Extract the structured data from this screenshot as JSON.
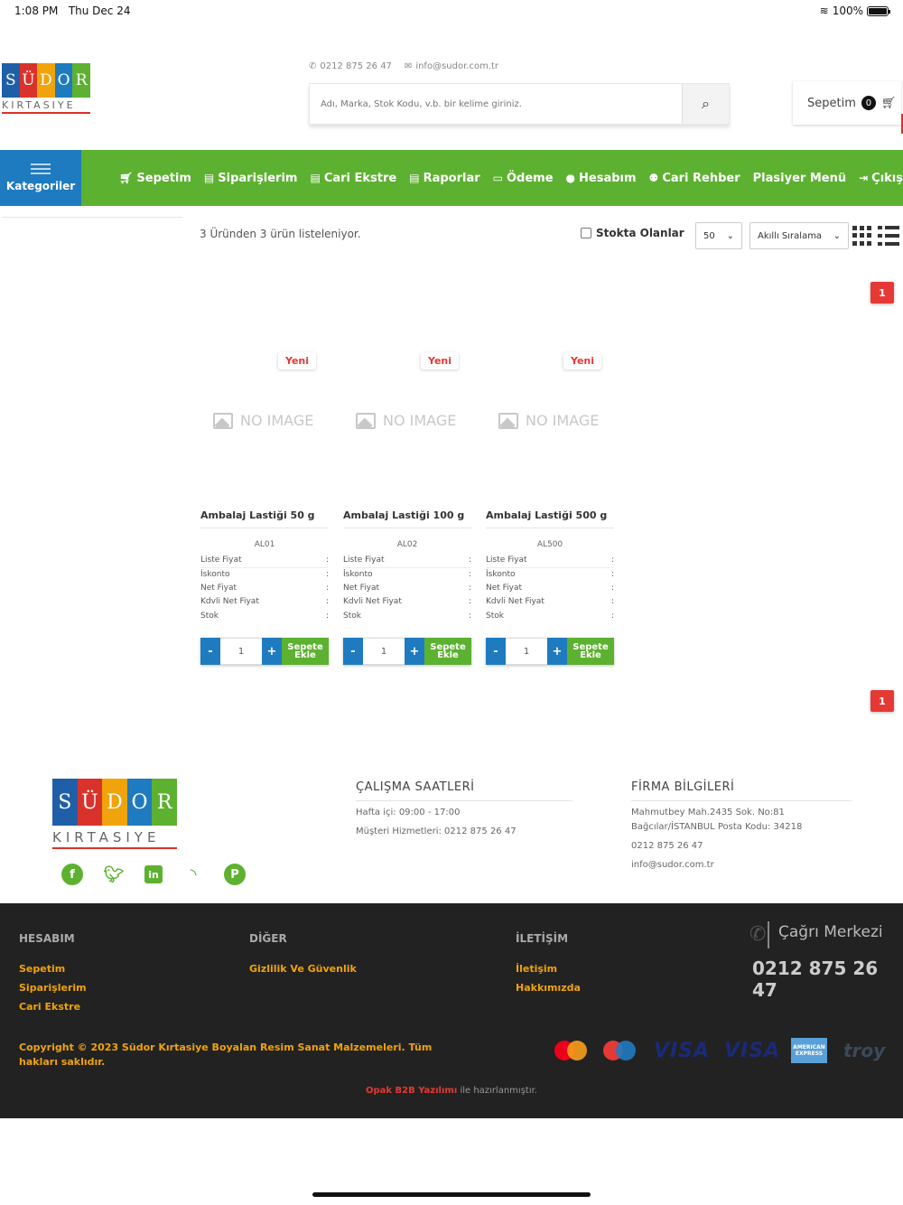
{
  "status_bar": {
    "time": "1:08 PM",
    "date": "Thu Dec 24",
    "battery": "100%"
  },
  "logo": {
    "letters": [
      "S",
      "Ü",
      "D",
      "O",
      "R"
    ],
    "tile_colors": [
      "#1f5fa8",
      "#d9322b",
      "#f0a30a",
      "#1f7bbf",
      "#5db130"
    ],
    "subtitle": "KIRTASIYE"
  },
  "header": {
    "phone": "0212 875 26 47",
    "email": "info@sudor.com.tr",
    "search_placeholder": "Adı, Marka, Stok Kodu, v.b. bir kelime giriniz.",
    "cart_label": "Sepetim",
    "cart_count": "0"
  },
  "nav": {
    "categories_label": "Kategoriler",
    "items": [
      {
        "label": "Sepetim",
        "icon": "cart-icon"
      },
      {
        "label": "Siparişlerim",
        "icon": "file-icon"
      },
      {
        "label": "Cari Ekstre",
        "icon": "file-icon"
      },
      {
        "label": "Raporlar",
        "icon": "file-icon"
      },
      {
        "label": "Ödeme",
        "icon": "credit-card-icon"
      },
      {
        "label": "Hesabım",
        "icon": "user-icon"
      },
      {
        "label": "Cari Rehber",
        "icon": "users-icon"
      },
      {
        "label": "Plasiyer Menü",
        "icon": ""
      },
      {
        "label": "Çıkış",
        "icon": "sign-out-icon"
      }
    ],
    "colors": {
      "bar": "#5db130",
      "categories": "#1f7bbf"
    }
  },
  "listing": {
    "result_text": "3 Üründen 3 ürün listeleniyor.",
    "stock_filter_label": "Stokta Olanlar",
    "page_size": "50",
    "sort": "Akıllı Sıralama",
    "page_top": "1",
    "page_bottom": "1"
  },
  "products": [
    {
      "badge": "Yeni",
      "no_image": "NO IMAGE",
      "name": "Ambalaj Lastiği 50 g",
      "code": "AL01",
      "specs": [
        {
          "label": "Liste Fiyat",
          "sep": ":"
        },
        {
          "label": "İskonto",
          "sep": ":"
        },
        {
          "label": "Net Fiyat",
          "sep": ":"
        },
        {
          "label": "Kdvli Net Fiyat",
          "sep": ":"
        },
        {
          "label": "Stok",
          "sep": ":"
        }
      ],
      "minus": "-",
      "qty": "1",
      "plus": "+",
      "add_label": "Sepete Ekle"
    },
    {
      "badge": "Yeni",
      "no_image": "NO IMAGE",
      "name": "Ambalaj Lastiği 100 g",
      "code": "AL02",
      "specs": [
        {
          "label": "Liste Fiyat",
          "sep": ":"
        },
        {
          "label": "İskonto",
          "sep": ":"
        },
        {
          "label": "Net Fiyat",
          "sep": ":"
        },
        {
          "label": "Kdvli Net Fiyat",
          "sep": ":"
        },
        {
          "label": "Stok",
          "sep": ":"
        }
      ],
      "minus": "-",
      "qty": "1",
      "plus": "+",
      "add_label": "Sepete Ekle"
    },
    {
      "badge": "Yeni",
      "no_image": "NO IMAGE",
      "name": "Ambalaj Lastiği 500 g",
      "code": "AL500",
      "specs": [
        {
          "label": "Liste Fiyat",
          "sep": ":"
        },
        {
          "label": "İskonto",
          "sep": ":"
        },
        {
          "label": "Net Fiyat",
          "sep": ":"
        },
        {
          "label": "Kdvli Net Fiyat",
          "sep": ":"
        },
        {
          "label": "Stok",
          "sep": ":"
        }
      ],
      "minus": "-",
      "qty": "1",
      "plus": "+",
      "add_label": "Sepete Ekle"
    }
  ],
  "footer": {
    "socials": [
      "facebook-icon",
      "twitter-icon",
      "linkedin-icon",
      "rss-icon",
      "pinterest-icon"
    ],
    "hours": {
      "title": "ÇALIŞMA SAATLERİ",
      "weekday": "Hafta içi: 09:00 - 17:00",
      "support": "Müşteri Hizmetleri: 0212 875 26 47"
    },
    "company": {
      "title": "FİRMA BİLGİLERİ",
      "address_1": "Mahmutbey Mah.2435 Sok. No:81",
      "address_2": "Bağcılar/İSTANBUL Posta Kodu: 34218",
      "phone": "0212 875 26 47",
      "email": "info@sudor.com.tr"
    },
    "account": {
      "title": "HESABIM",
      "links": [
        "Sepetim",
        "Siparişlerim",
        "Cari Ekstre"
      ]
    },
    "other": {
      "title": "DİĞER",
      "links": [
        "Gizlilik Ve Güvenlik"
      ]
    },
    "contact": {
      "title": "İLETİŞİM",
      "links": [
        "İletişim",
        "Hakkımızda"
      ]
    },
    "call_center": {
      "label": "Çağrı Merkezi",
      "number": "0212 875 26 47"
    },
    "copyright": "Copyright © 2023 Südor Kırtasiye Boyalan Resim Sanat Malzemeleri. Tüm hakları saklıdır.",
    "credit_brand": "Opak B2B Yazılımı",
    "credit_rest": " ile hazırlanmıştır.",
    "payment": {
      "visa": "VISA",
      "amex": "AMERICAN EXPRESS",
      "troy": "troy"
    }
  }
}
